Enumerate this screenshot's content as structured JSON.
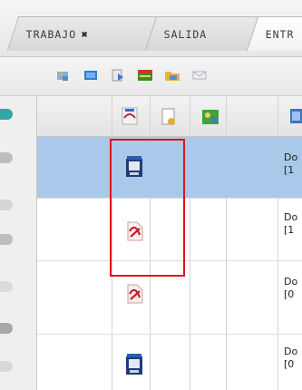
{
  "tabs": [
    {
      "label": "TRABAJO",
      "close": "✖"
    },
    {
      "label": "SALIDA"
    },
    {
      "label": "ENTR"
    }
  ],
  "toolbar": {
    "icons": [
      "tool-a-icon",
      "tool-b-icon",
      "tool-c-icon",
      "tool-d-icon",
      "tool-e-icon",
      "tool-f-icon"
    ]
  },
  "rows": [
    {
      "icon": "scanned-document-icon",
      "text": "Do\n[1",
      "selected": true
    },
    {
      "icon": "pdf-document-icon",
      "text": "Do\n[1",
      "selected": false
    },
    {
      "icon": "pdf-document-icon",
      "text": "Do\n[0",
      "selected": false
    },
    {
      "icon": "scanned-document-icon",
      "text": "Do\n[0",
      "selected": false
    }
  ],
  "colors": {
    "selection": "#a9c8ea",
    "highlight": "#e0141c"
  }
}
